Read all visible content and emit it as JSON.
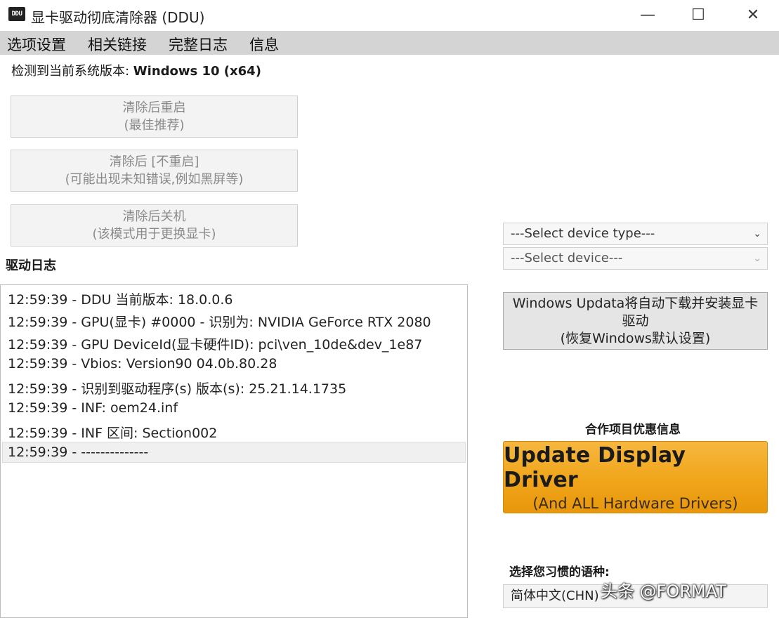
{
  "window": {
    "title": "显卡驱动彻底清除器 (DDU)",
    "icon_text": "DDU",
    "controls": {
      "minimize": "—",
      "maximize": "☐",
      "close": "✕"
    }
  },
  "menu": [
    "选项设置",
    "相关链接",
    "完整日志",
    "信息"
  ],
  "os": {
    "label": "检测到当前系统版本: ",
    "value": "Windows 10 (x64)"
  },
  "actions": [
    {
      "line1": "清除后重启",
      "line2": "(最佳推荐)"
    },
    {
      "line1": "清除后 [不重启]",
      "line2": "(可能出现未知错误,例如黑屏等)"
    },
    {
      "line1": "清除后关机",
      "line2": "(该模式用于更换显卡)"
    }
  ],
  "log": {
    "title": "驱动日志",
    "lines": [
      "12:59:39 - DDU 当前版本: 18.0.0.6",
      "12:59:39 - GPU(显卡) #0000 - 识别为: NVIDIA GeForce RTX 2080",
      "12:59:39 - GPU DeviceId(显卡硬件ID): pci\\ven_10de&dev_1e87",
      "12:59:39 - Vbios: Version90 04.0b.80.28",
      "12:59:39 - 识别到驱动程序(s) 版本(s): 25.21.14.1735",
      "12:59:39 - INF: oem24.inf",
      "12:59:39 - INF 区间: Section002",
      "12:59:39 - --------------"
    ]
  },
  "device_type_select": {
    "value": "---Select device type---"
  },
  "device_select": {
    "value": "---Select device---"
  },
  "windows_update_button": "Windows Updata将自动下载并安装显卡驱动\n(恢复Windows默认设置)",
  "partner": {
    "label": "合作项目优惠信息",
    "promo_main": "Update Display Driver",
    "promo_sub": "(And ALL Hardware Drivers)"
  },
  "language": {
    "label": "选择您习惯的语种:",
    "value": "简体中文(CHN)"
  },
  "watermark": "头条 @FORMAT",
  "icons": [
    "ddu-app-icon",
    "minimize-icon",
    "maximize-icon",
    "close-icon",
    "chevron-down-icon"
  ]
}
